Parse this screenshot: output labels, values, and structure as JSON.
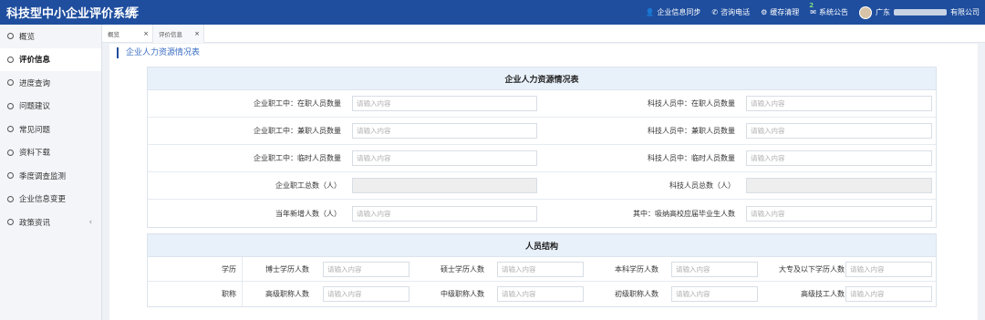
{
  "app": {
    "title": "科技型中小企业评价系统",
    "menu_icon": "hamburger-icon"
  },
  "top_actions": [
    {
      "icon": "user-icon",
      "label": "企业信息同步"
    },
    {
      "icon": "phone-icon",
      "label": "咨询电话"
    },
    {
      "icon": "gear-icon",
      "label": "缓存清理"
    },
    {
      "icon": "bell-icon",
      "label": "系统公告",
      "badge": "2"
    }
  ],
  "user": {
    "prefix": "广东",
    "suffix": "有限公司"
  },
  "sidebar": {
    "items": [
      {
        "label": "概览"
      },
      {
        "label": "评价信息"
      },
      {
        "label": "进度查询"
      },
      {
        "label": "问题建议"
      },
      {
        "label": "常见问题"
      },
      {
        "label": "资料下载"
      },
      {
        "label": "季度调查监测"
      },
      {
        "label": "企业信息变更"
      },
      {
        "label": "政策资讯",
        "chevron": "‹"
      }
    ]
  },
  "tabs": [
    {
      "label": "概览",
      "close": "×"
    },
    {
      "label": "评价信息",
      "close": "×"
    }
  ],
  "section_title": "企业人力资源情况表",
  "hr_table": {
    "header": "企业人力资源情况表",
    "rows": [
      {
        "left_label": "企业职工中：在职人员数量",
        "left_placeholder": "请输入内容",
        "right_label": "科技人员中：在职人员数量",
        "right_placeholder": "请输入内容"
      },
      {
        "left_label": "企业职工中：兼职人员数量",
        "left_placeholder": "请输入内容",
        "right_label": "科技人员中：兼职人员数量",
        "right_placeholder": "请输入内容"
      },
      {
        "left_label": "企业职工中：临时人员数量",
        "left_placeholder": "请输入内容",
        "right_label": "科技人员中：临时人员数量",
        "right_placeholder": "请输入内容"
      },
      {
        "left_label": "企业职工总数（人）",
        "left_placeholder": "",
        "right_label": "科技人员总数（人）",
        "right_placeholder": ""
      },
      {
        "left_label": "当年新增人数（人）",
        "left_placeholder": "请输入内容",
        "right_label": "其中：吸纳高校应届毕业生人数",
        "right_placeholder": "请输入内容"
      }
    ]
  },
  "structure": {
    "header": "人员结构",
    "rows": [
      {
        "category": "学历",
        "fields": [
          {
            "label": "博士学历人数",
            "placeholder": "请输入内容"
          },
          {
            "label": "硕士学历人数",
            "placeholder": "请输入内容"
          },
          {
            "label": "本科学历人数",
            "placeholder": "请输入内容"
          },
          {
            "label": "大专及以下学历人数",
            "placeholder": "请输入内容"
          }
        ]
      },
      {
        "category": "职称",
        "fields": [
          {
            "label": "高级职称人数",
            "placeholder": "请输入内容"
          },
          {
            "label": "中级职称人数",
            "placeholder": "请输入内容"
          },
          {
            "label": "初级职称人数",
            "placeholder": "请输入内容"
          },
          {
            "label": "高级技工人数",
            "placeholder": "请输入内容"
          }
        ]
      }
    ]
  },
  "colors": {
    "topbar": "#1f4e9e",
    "table_header": "#e8f1fa",
    "accent_text": "#3a6ec2"
  }
}
